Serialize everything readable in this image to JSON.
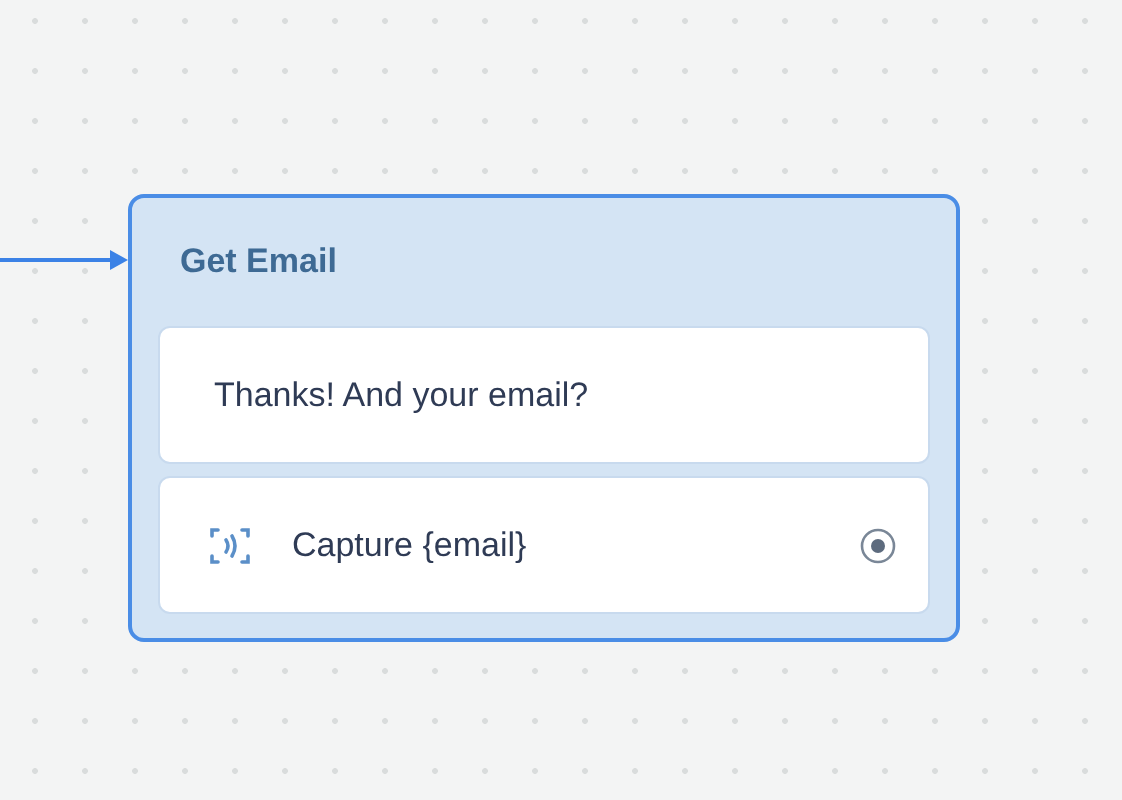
{
  "node": {
    "title": "Get Email",
    "steps": [
      {
        "kind": "message",
        "text": "Thanks! And your email?"
      },
      {
        "kind": "capture",
        "text": "Capture {email}"
      }
    ]
  }
}
